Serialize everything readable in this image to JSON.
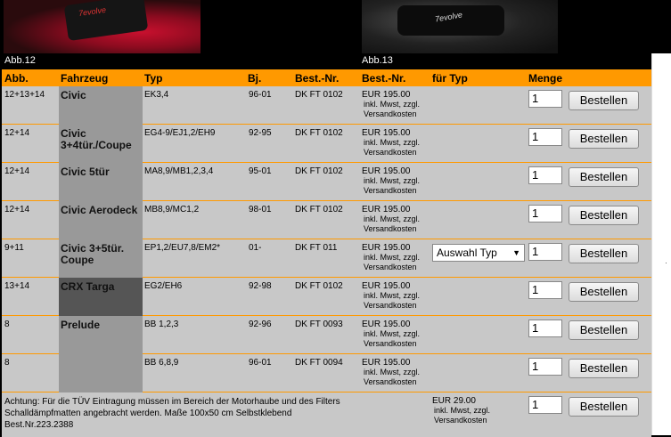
{
  "images": [
    {
      "caption": "Abb.12",
      "logo": "7evolve"
    },
    {
      "caption": "Abb.13",
      "logo": "7evolve"
    }
  ],
  "headers": {
    "abb": "Abb.",
    "fahrzeug": "Fahrzeug",
    "typ": "Typ",
    "bj": "Bj.",
    "bestnr": "Best.-Nr.",
    "bestnr2": "Best.-Nr.",
    "fuertyp": "für Typ",
    "menge": "Menge"
  },
  "rows": [
    {
      "abb": "12+13+14",
      "fahrzeug": "Civic",
      "typ": "EK3,4",
      "bj": "96-01",
      "best": "DK FT 0102",
      "price": "EUR 195.00",
      "sub1": "inkl. Mwst, zzgl.",
      "sub2": "Versandkosten",
      "qty": "1",
      "button": "Bestellen",
      "select": ""
    },
    {
      "abb": "12+14",
      "fahrzeug": "Civic 3+4tür./Coupe",
      "typ": "EG4-9/EJ1,2/EH9",
      "bj": "92-95",
      "best": "DK FT 0102",
      "price": "EUR 195.00",
      "sub1": "inkl. Mwst, zzgl.",
      "sub2": "Versandkosten",
      "qty": "1",
      "button": "Bestellen",
      "select": ""
    },
    {
      "abb": "12+14",
      "fahrzeug": "Civic 5tür",
      "typ": "MA8,9/MB1,2,3,4",
      "bj": "95-01",
      "best": "DK FT 0102",
      "price": "EUR 195.00",
      "sub1": "inkl. Mwst, zzgl.",
      "sub2": "Versandkosten",
      "qty": "1",
      "button": "Bestellen",
      "select": ""
    },
    {
      "abb": "12+14",
      "fahrzeug": "Civic Aerodeck",
      "typ": "MB8,9/MC1,2",
      "bj": "98-01",
      "best": "DK FT 0102",
      "price": "EUR 195.00",
      "sub1": "inkl. Mwst, zzgl.",
      "sub2": "Versandkosten",
      "qty": "1",
      "button": "Bestellen",
      "select": ""
    },
    {
      "abb": "9+11",
      "fahrzeug": "Civic 3+5tür. Coupe",
      "typ": "EP1,2/EU7,8/EM2*",
      "bj": "01-",
      "best": "DK FT 011",
      "price": "EUR 195.00",
      "sub1": "inkl. Mwst, zzgl.",
      "sub2": "Versandkosten",
      "qty": "1",
      "button": "Bestellen",
      "select": "Auswahl Typ"
    },
    {
      "abb": "13+14",
      "fahrzeug": "CRX Targa",
      "typ": "EG2/EH6",
      "bj": "92-98",
      "best": "DK FT 0102",
      "price": "EUR 195.00",
      "sub1": "inkl. Mwst, zzgl.",
      "sub2": "Versandkosten",
      "qty": "1",
      "button": "Bestellen",
      "select": ""
    },
    {
      "abb": "8",
      "fahrzeug": "Prelude",
      "typ": "BB 1,2,3",
      "bj": "92-96",
      "best": "DK FT 0093",
      "price": "EUR 195.00",
      "sub1": "inkl. Mwst, zzgl.",
      "sub2": "Versandkosten",
      "qty": "1",
      "button": "Bestellen",
      "select": ""
    },
    {
      "abb": "8",
      "fahrzeug": "",
      "typ": "BB 6,8,9",
      "bj": "96-01",
      "best": "DK FT 0094",
      "price": "EUR 195.00",
      "sub1": "inkl. Mwst, zzgl.",
      "sub2": "Versandkosten",
      "qty": "1",
      "button": "Bestellen",
      "select": ""
    }
  ],
  "footer": {
    "text1": "Achtung: Für die TÜV Eintragung müssen im Bereich der Motorhaube und des Filters",
    "text2": "Schalldämpfmatten angebracht werden. Maße 100x50 cm Selbstklebend",
    "text3": "Best.Nr.223.2388",
    "price": "EUR 29.00",
    "sub1": "inkl. Mwst, zzgl.",
    "sub2": "Versandkosten",
    "qty": "1",
    "button": "Bestellen"
  },
  "colors": {
    "accent": "#ff9900",
    "rowbg": "#c8c8c8",
    "fahrzeugbg": "#999999",
    "crxbg": "#555555"
  }
}
